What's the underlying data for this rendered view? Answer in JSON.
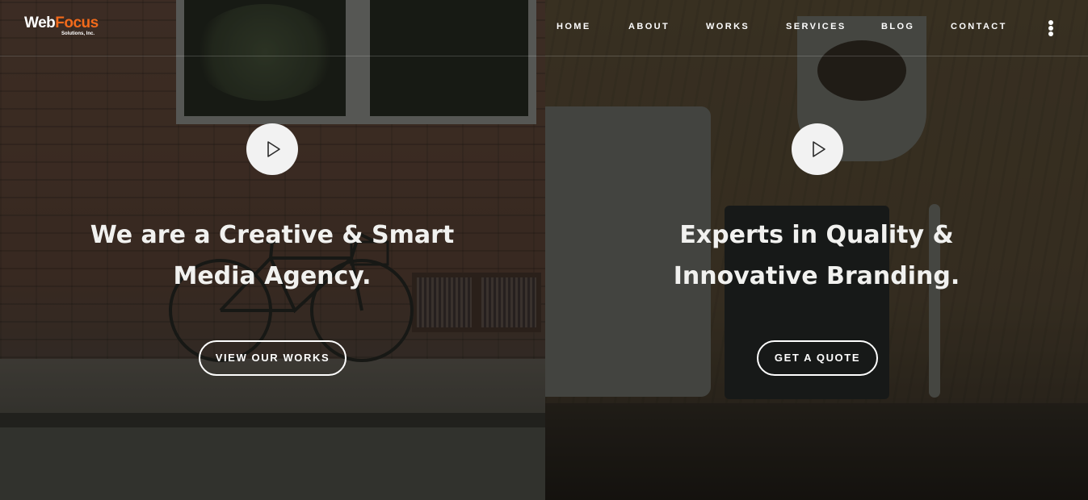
{
  "brand": {
    "logo_word1": "Web",
    "logo_word2": "Focus",
    "logo_sub": "Solutions, Inc.",
    "accent_color": "#f26a1b"
  },
  "nav": {
    "items": [
      "HOME",
      "ABOUT",
      "WORKS",
      "SERVICES",
      "BLOG",
      "CONTACT"
    ],
    "more_icon": "kebab-menu-icon"
  },
  "slides": [
    {
      "play_icon": "play-icon",
      "headline_line1": "We are a Creative & Smart",
      "headline_line2": "Media Agency.",
      "cta_label": "VIEW OUR WORKS"
    },
    {
      "play_icon": "play-icon",
      "headline_line1": "Experts in Quality &",
      "headline_line2": "Innovative Branding.",
      "cta_label": "GET A QUOTE"
    }
  ]
}
